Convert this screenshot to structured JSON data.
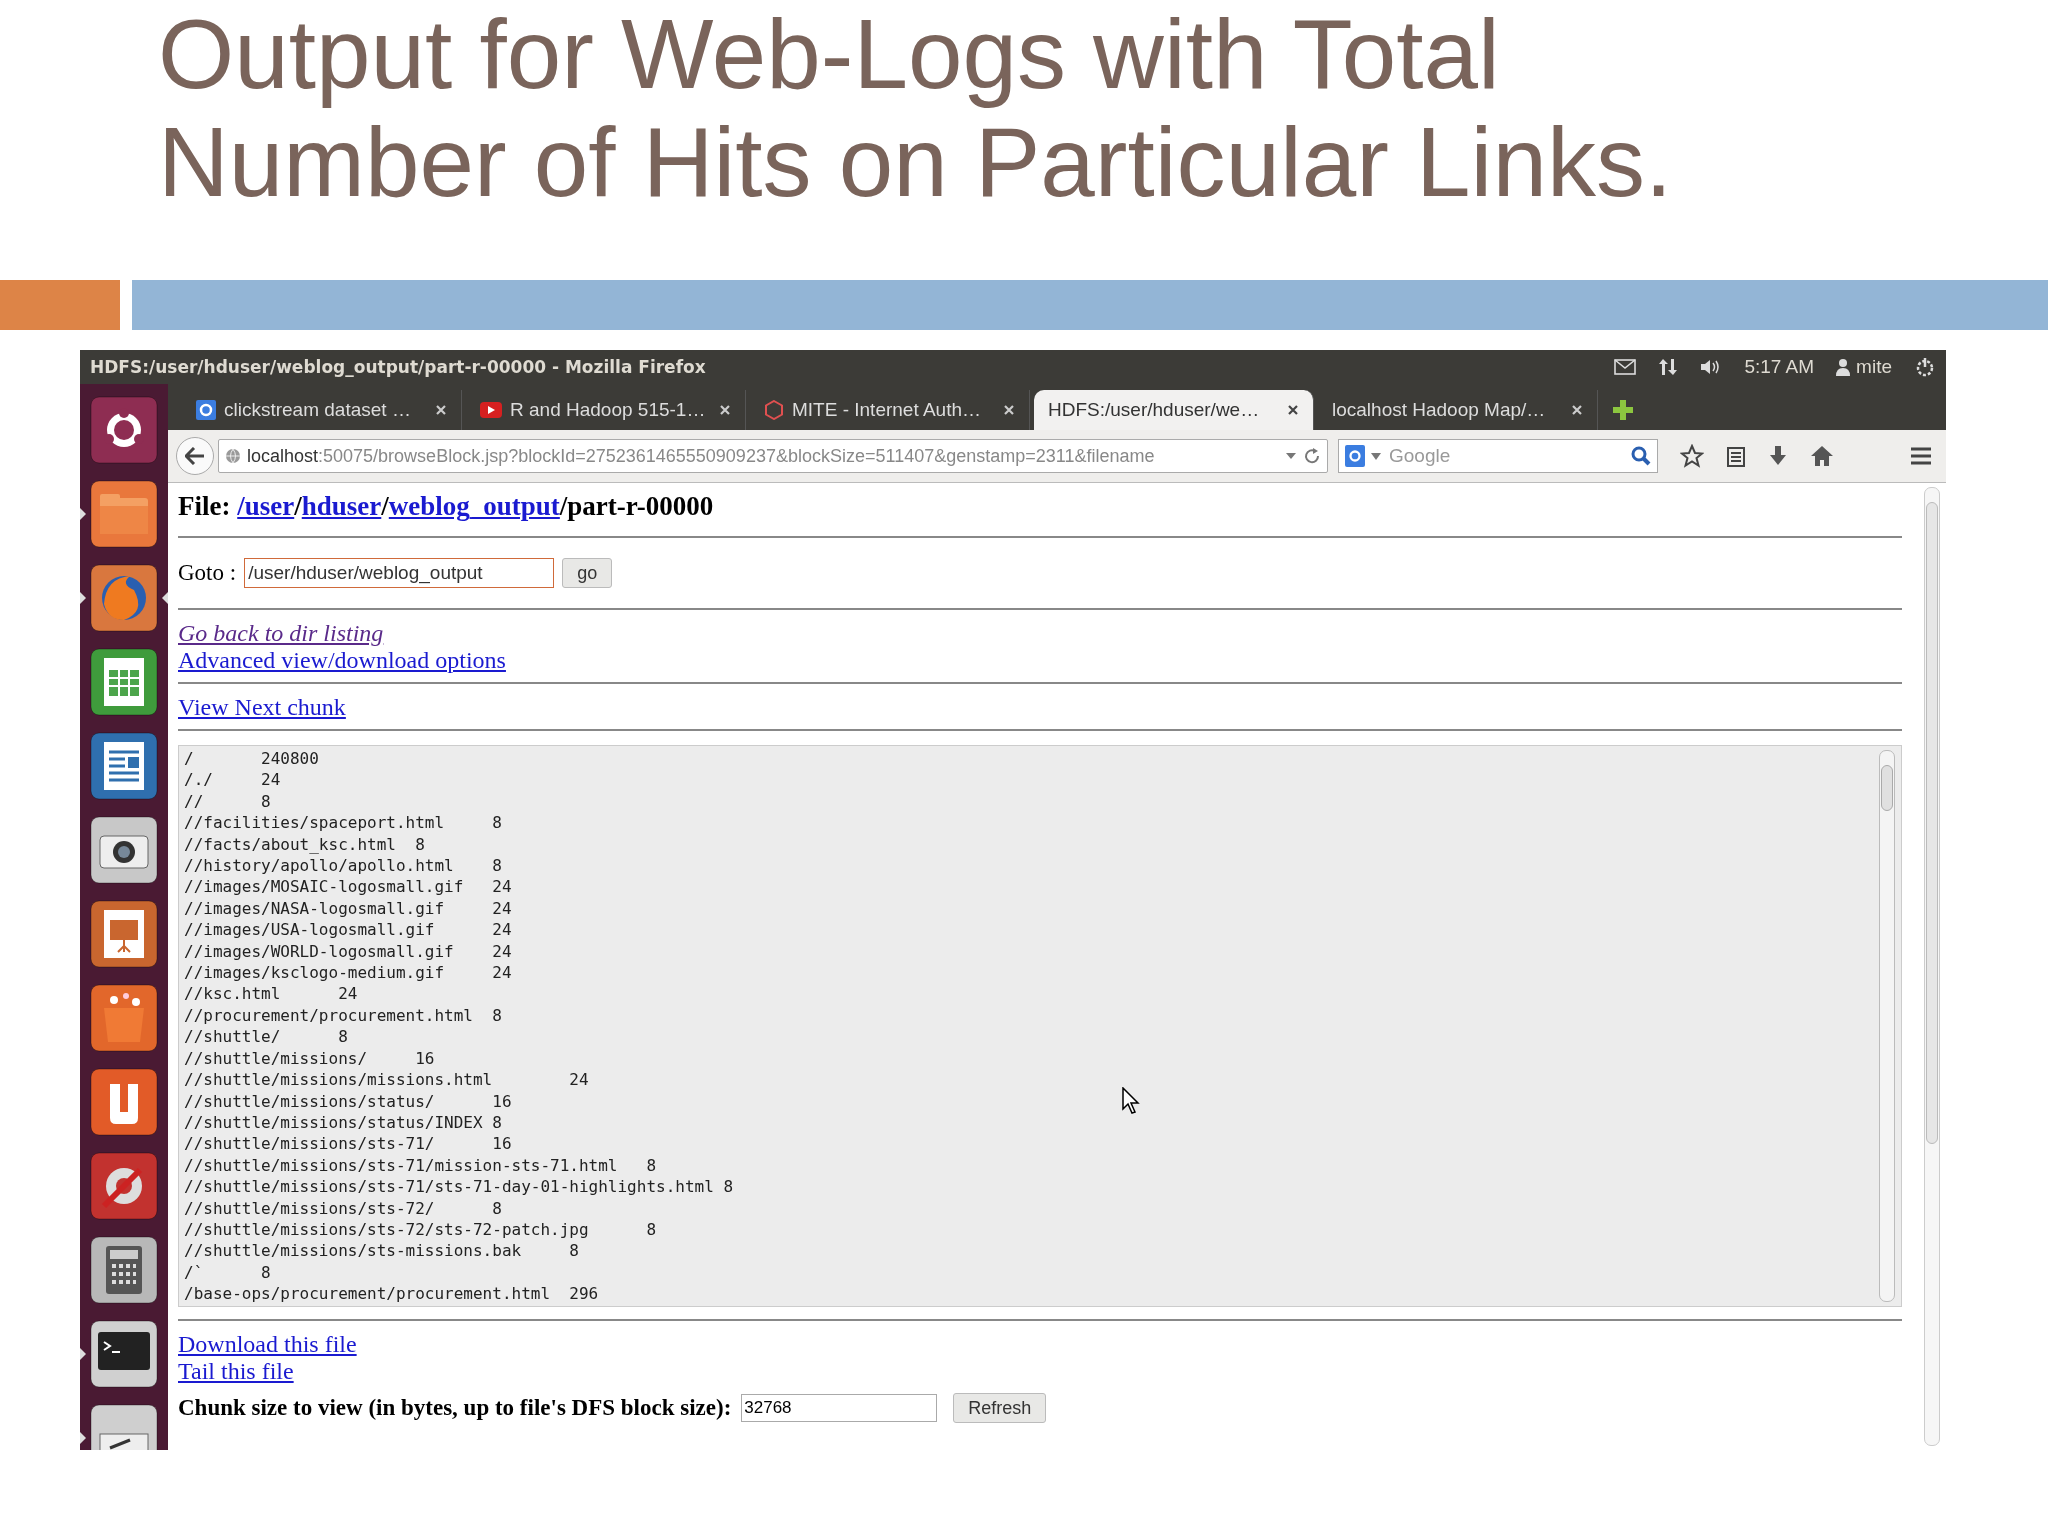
{
  "slide": {
    "title_lines": [
      "Output for Web-Logs with Total",
      "Number of Hits on Particular Links."
    ]
  },
  "window": {
    "title": "HDFS:/user/hduser/weblog_output/part-r-00000 - Mozilla Firefox",
    "time": "5:17 AM",
    "user": "mite"
  },
  "launcher": [
    {
      "kind": "ubuntu",
      "running": false,
      "focused": false
    },
    {
      "kind": "files",
      "running": true,
      "focused": false
    },
    {
      "kind": "firefox",
      "running": true,
      "focused": true
    },
    {
      "kind": "spreadsheet",
      "running": false,
      "focused": false
    },
    {
      "kind": "document",
      "running": false,
      "focused": false
    },
    {
      "kind": "camera",
      "running": false,
      "focused": false
    },
    {
      "kind": "presentation",
      "running": false,
      "focused": false
    },
    {
      "kind": "store",
      "running": false,
      "focused": false
    },
    {
      "kind": "cloud",
      "running": false,
      "focused": false
    },
    {
      "kind": "settings",
      "running": false,
      "focused": false
    },
    {
      "kind": "calculator",
      "running": false,
      "focused": false
    },
    {
      "kind": "terminal",
      "running": true,
      "focused": false
    },
    {
      "kind": "scanner",
      "running": true,
      "focused": false
    }
  ],
  "tabs": [
    {
      "label": "clickstream dataset …",
      "kind": "search",
      "selected": false
    },
    {
      "label": "R and Hadoop 515-1…",
      "kind": "video",
      "selected": false
    },
    {
      "label": "MITE - Internet Auth…",
      "kind": "site",
      "selected": false
    },
    {
      "label": "HDFS:/user/hduser/we…",
      "kind": "plain",
      "selected": true
    },
    {
      "label": "localhost Hadoop Map/…",
      "kind": "plain",
      "selected": false
    }
  ],
  "address_bar": {
    "host": "localhost",
    "rest": ":50075/browseBlock.jsp?blockId=2752361465550909237&blockSize=511407&genstamp=2311&filename"
  },
  "search": {
    "placeholder": "Google"
  },
  "page": {
    "heading": [
      {
        "kind": "text",
        "text": "File: "
      },
      {
        "kind": "link",
        "text": "/user"
      },
      {
        "kind": "text",
        "text": "/"
      },
      {
        "kind": "link",
        "text": "hduser"
      },
      {
        "kind": "text",
        "text": "/"
      },
      {
        "kind": "link",
        "text": "weblog_output"
      },
      {
        "kind": "text",
        "text": "/part-r-00000"
      }
    ],
    "goto": {
      "label": "Goto :",
      "value": "/user/hduser/weblog_output",
      "button": "go"
    },
    "links": [
      {
        "text": "Go back to dir listing",
        "visited": true
      },
      {
        "text": "Advanced view/download options",
        "visited": false
      }
    ],
    "next_chunk": "View Next chunk",
    "log": [
      {
        "path": "/",
        "count": "240800"
      },
      {
        "path": "/./",
        "count": "24"
      },
      {
        "path": "//",
        "count": "8"
      },
      {
        "path": "//facilities/spaceport.html",
        "count": "8"
      },
      {
        "path": "//facts/about_ksc.html",
        "count": "8"
      },
      {
        "path": "//history/apollo/apollo.html",
        "count": "8"
      },
      {
        "path": "//images/MOSAIC-logosmall.gif",
        "count": "24"
      },
      {
        "path": "//images/NASA-logosmall.gif",
        "count": "24"
      },
      {
        "path": "//images/USA-logosmall.gif",
        "count": "24"
      },
      {
        "path": "//images/WORLD-logosmall.gif",
        "count": "24"
      },
      {
        "path": "//images/ksclogo-medium.gif",
        "count": "24"
      },
      {
        "path": "//ksc.html",
        "count": "24"
      },
      {
        "path": "//procurement/procurement.html",
        "count": "8"
      },
      {
        "path": "//shuttle/",
        "count": "8"
      },
      {
        "path": "//shuttle/missions/",
        "count": "16"
      },
      {
        "path": "//shuttle/missions/missions.html",
        "count": "24"
      },
      {
        "path": "//shuttle/missions/status/",
        "count": "16"
      },
      {
        "path": "//shuttle/missions/status/INDEX",
        "count": "8"
      },
      {
        "path": "//shuttle/missions/sts-71/",
        "count": "16"
      },
      {
        "path": "//shuttle/missions/sts-71/mission-sts-71.html",
        "count": "8"
      },
      {
        "path": "//shuttle/missions/sts-71/sts-71-day-01-highlights.html",
        "count": "8"
      },
      {
        "path": "//shuttle/missions/sts-72/",
        "count": "8"
      },
      {
        "path": "//shuttle/missions/sts-72/sts-72-patch.jpg",
        "count": "8"
      },
      {
        "path": "//shuttle/missions/sts-missions.bak",
        "count": "8"
      },
      {
        "path": "/`",
        "count": "8"
      },
      {
        "path": "/base-ops/procurement/procurement.html",
        "count": "296"
      }
    ],
    "bottom_links": [
      "Download this file",
      "Tail this file"
    ],
    "chunk": {
      "label": "Chunk size to view (in bytes, up to file's DFS block size):",
      "value": "32768",
      "button": "Refresh"
    }
  }
}
